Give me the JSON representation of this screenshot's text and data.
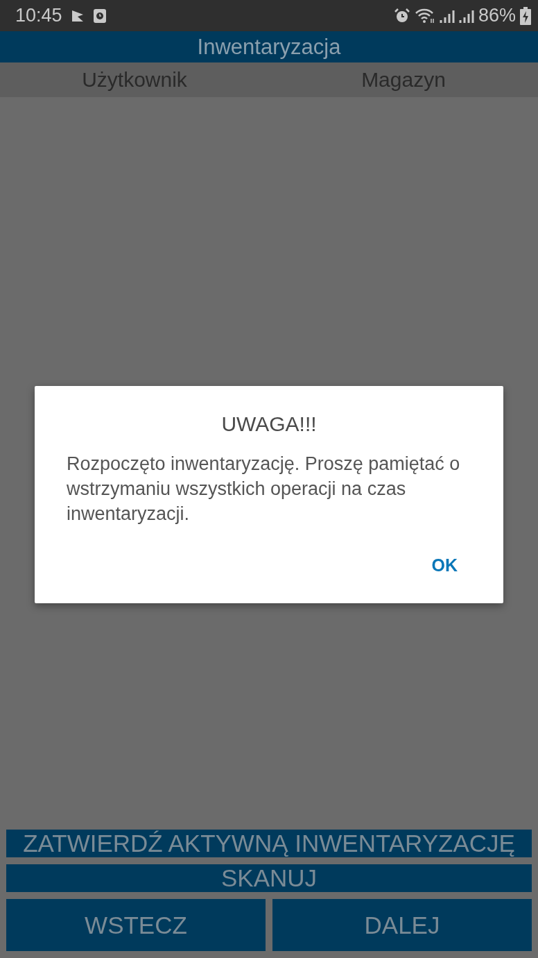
{
  "status_bar": {
    "time": "10:45",
    "battery": "86%"
  },
  "app_bar": {
    "title": "Inwentaryzacja"
  },
  "table": {
    "columns": [
      "Użytkownik",
      "Magazyn"
    ]
  },
  "buttons": [
    {
      "label": "ZATWIERDŹ AKTYWNĄ INWENTARYZACJĘ"
    },
    {
      "label": "SKANUJ"
    },
    {
      "label": "WSTECZ"
    },
    {
      "label": "DALEJ"
    }
  ],
  "dialog": {
    "title": "UWAGA!!!",
    "message": "Rozpoczęto inwentaryzację. Proszę pamiętać o wstrzymaniu wszystkich operacji na czas inwentaryzacji.",
    "buttons": [
      "OK"
    ]
  }
}
